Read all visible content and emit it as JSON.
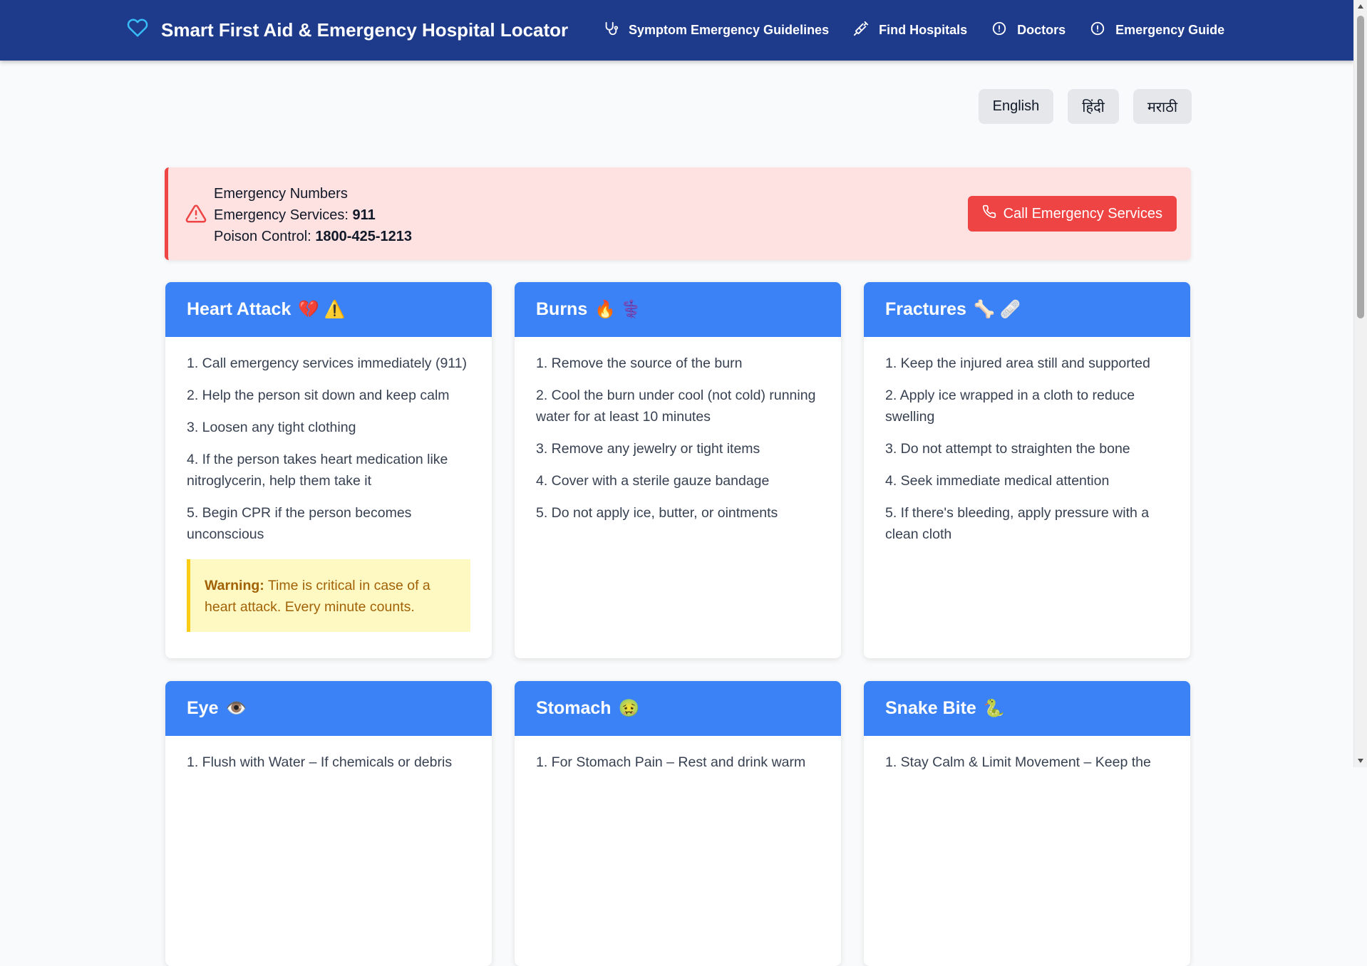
{
  "navbar": {
    "brand": "Smart First Aid & Emergency Hospital Locator",
    "links": [
      {
        "label": "Symptom Emergency Guidelines",
        "icon": "stethoscope-icon"
      },
      {
        "label": "Find Hospitals",
        "icon": "syringe-icon"
      },
      {
        "label": "Doctors",
        "icon": "info-circle-icon"
      },
      {
        "label": "Emergency Guide",
        "icon": "info-circle-icon"
      }
    ]
  },
  "languages": [
    "English",
    "हिंदी",
    "मराठी"
  ],
  "banner": {
    "title": "Emergency Numbers",
    "services_label": "Emergency Services:",
    "services_number": "911",
    "poison_label": "Poison Control:",
    "poison_number": "1800-425-1213",
    "call_button": "Call Emergency Services"
  },
  "cards": [
    {
      "title": "Heart Attack",
      "emoji": "💔 ⚠️",
      "steps": [
        "1. Call emergency services immediately (911)",
        "2. Help the person sit down and keep calm",
        "3. Loosen any tight clothing",
        "4. If the person takes heart medication like nitroglycerin, help them take it",
        "5. Begin CPR if the person becomes unconscious"
      ],
      "warning_label": "Warning:",
      "warning_text": "Time is critical in case of a heart attack. Every minute counts."
    },
    {
      "title": "Burns",
      "emoji": "🔥 ⚕️",
      "steps": [
        "1. Remove the source of the burn",
        "2. Cool the burn under cool (not cold) running water for at least 10 minutes",
        "3. Remove any jewelry or tight items",
        "4. Cover with a sterile gauze bandage",
        "5. Do not apply ice, butter, or ointments"
      ]
    },
    {
      "title": "Fractures",
      "emoji": "🦴 🩹",
      "steps": [
        "1. Keep the injured area still and supported",
        "2. Apply ice wrapped in a cloth to reduce swelling",
        "3. Do not attempt to straighten the bone",
        "4. Seek immediate medical attention",
        "5. If there's bleeding, apply pressure with a clean cloth"
      ]
    },
    {
      "title": "Eye",
      "emoji": "👁️",
      "steps": [
        "1. Flush with Water – If chemicals or debris"
      ]
    },
    {
      "title": "Stomach",
      "emoji": "🤢",
      "steps": [
        "1. For Stomach Pain – Rest and drink warm"
      ]
    },
    {
      "title": "Snake Bite",
      "emoji": "🐍",
      "steps": [
        "1. Stay Calm & Limit Movement – Keep the"
      ]
    }
  ]
}
